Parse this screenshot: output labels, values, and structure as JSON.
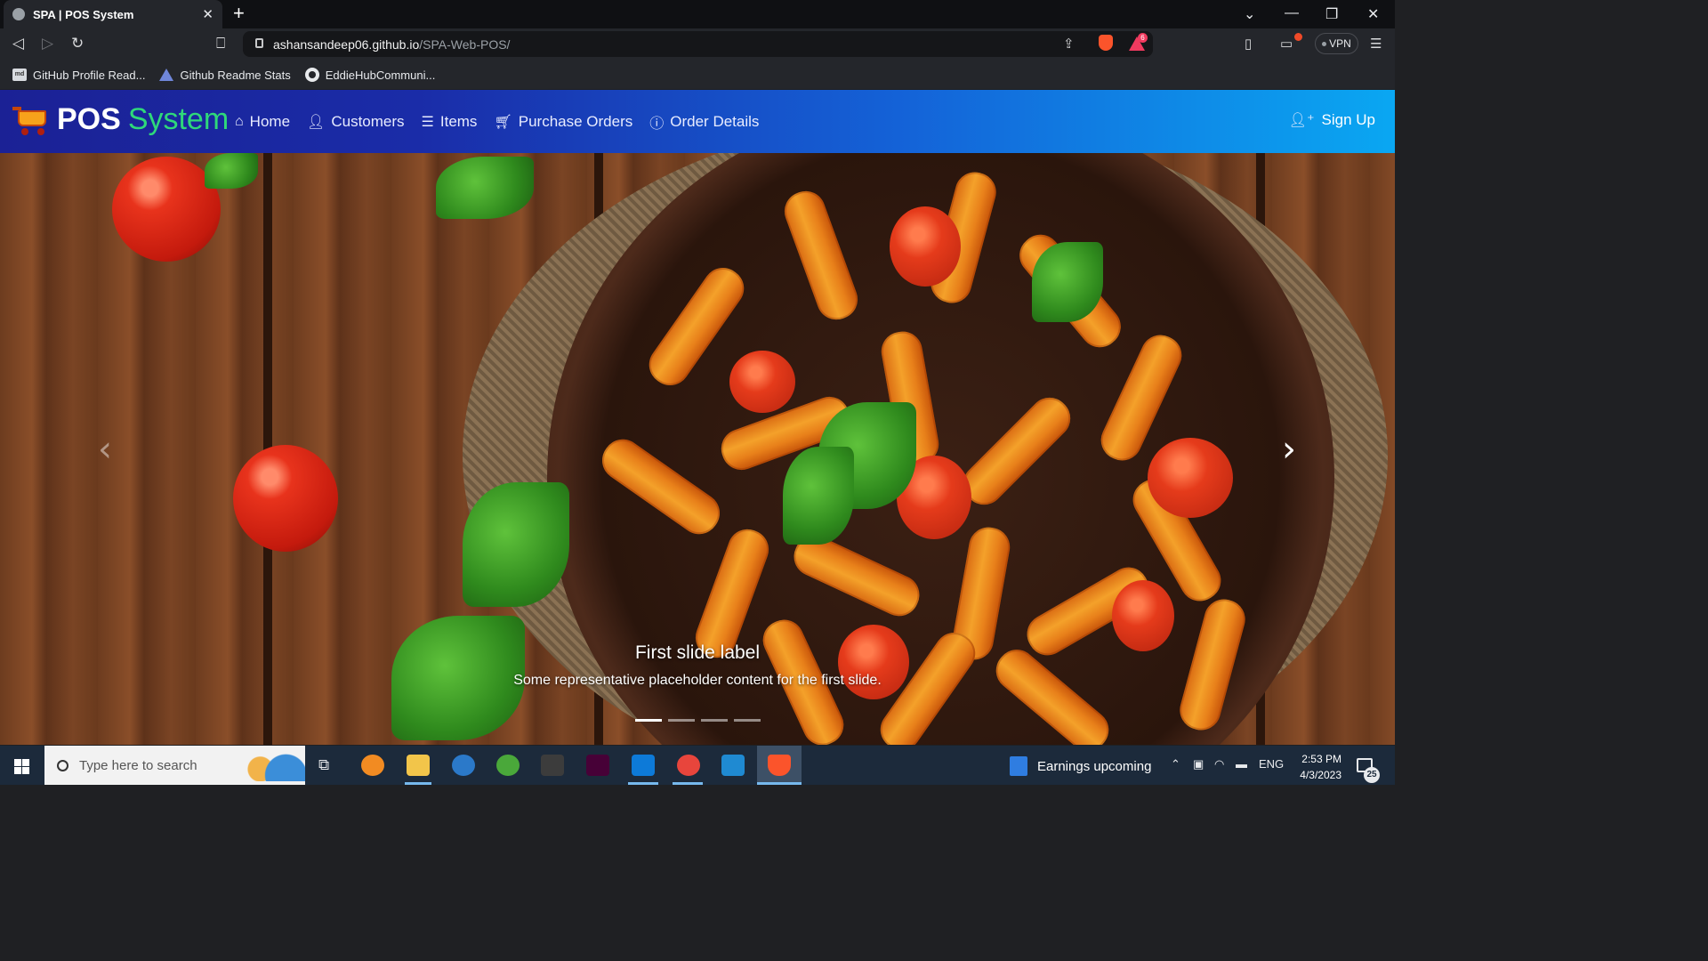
{
  "browser": {
    "tab_title": "SPA | POS System",
    "tab_close": "✕",
    "new_tab": "+",
    "url_host": "ashansandeep06.github.io",
    "url_path": "/SPA-Web-POS/",
    "bat_count": "6",
    "vpn_label": "VPN",
    "bookmarks": [
      {
        "label": "GitHub Profile Read...",
        "icon": "readme-icon"
      },
      {
        "label": "Github Readme Stats",
        "icon": "triangle-icon"
      },
      {
        "label": "EddieHubCommuni...",
        "icon": "github-icon"
      }
    ]
  },
  "navbar": {
    "brand_pos": "POS",
    "brand_system": "System",
    "items": [
      {
        "label": "Home",
        "icon": "home-icon"
      },
      {
        "label": "Customers",
        "icon": "user-icon"
      },
      {
        "label": "Items",
        "icon": "database-icon"
      },
      {
        "label": "Purchase Orders",
        "icon": "cart-icon"
      },
      {
        "label": "Order Details",
        "icon": "info-icon"
      }
    ],
    "signup_label": "Sign Up"
  },
  "carousel": {
    "caption_title": "First slide label",
    "caption_text": "Some representative placeholder content for the first slide.",
    "slide_count": 4,
    "active_slide": 1
  },
  "taskbar": {
    "search_placeholder": "Type here to search",
    "news_label": "Earnings upcoming",
    "language": "ENG",
    "time": "2:53 PM",
    "date": "4/3/2023",
    "notification_count": "25"
  },
  "colors": {
    "navbar_start": "#1b2195",
    "navbar_end": "#0aa7f2",
    "brand_accent": "#2fd87a"
  }
}
